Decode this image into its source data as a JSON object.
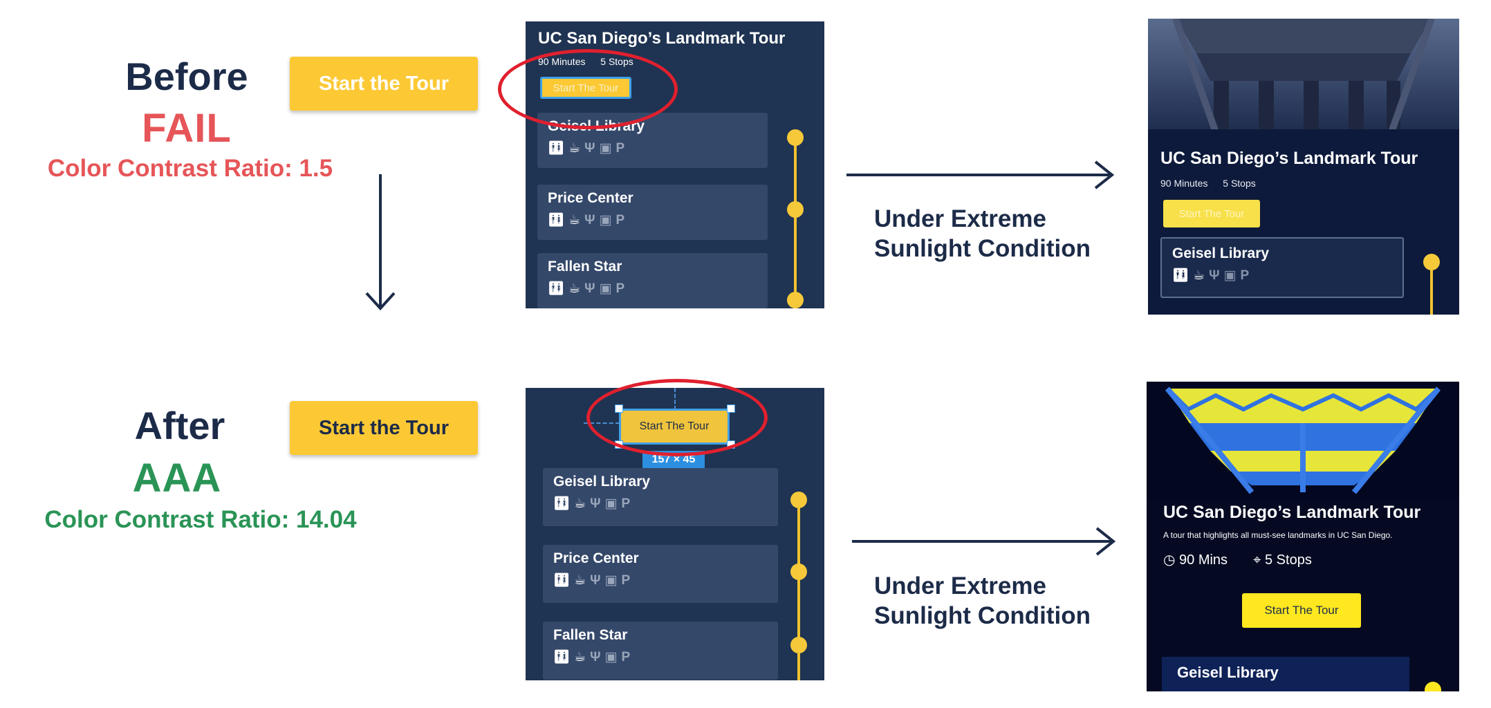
{
  "before": {
    "headline": "Before",
    "verdict": "FAIL",
    "ratio_text": "Color Contrast Ratio: 1.5",
    "sample_button": "Start the Tour"
  },
  "after": {
    "headline": "After",
    "verdict": "AAA",
    "ratio_text": "Color Contrast Ratio: 14.04",
    "sample_button": "Start the Tour"
  },
  "sunlight_label": {
    "line1": "Under Extreme",
    "line2": "Sunlight Condition"
  },
  "tour_panel": {
    "title": "UC San Diego’s Landmark Tour",
    "minutes": "90 Minutes",
    "stops": "5 Stops",
    "button": "Start The Tour",
    "stop_names": [
      "Geisel Library",
      "Price Center",
      "Fallen Star"
    ]
  },
  "after_panel": {
    "button": "Start The Tour",
    "size_badge": "157 × 45"
  },
  "sunlight_after": {
    "title": "UC San Diego’s Landmark Tour",
    "description": "A tour that highlights all must-see landmarks in UC San Diego.",
    "mins": "90 Mins",
    "stops": "5 Stops",
    "button": "Start The Tour",
    "first_stop": "Geisel Library"
  },
  "amenities": [
    "restroom-icon",
    "coffee-icon",
    "dining-icon",
    "bus-icon",
    "parking-icon"
  ],
  "colors": {
    "navy": "#1c2b48",
    "fail_red": "#e65558",
    "pass_green": "#2a9456",
    "button_yellow": "#fcc935",
    "annotation_red": "#e0202e",
    "panel_bg": "#1f3352"
  }
}
